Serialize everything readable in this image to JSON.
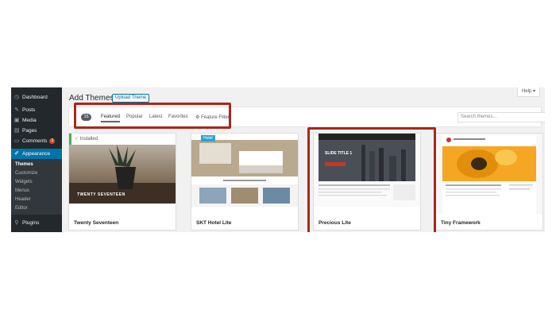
{
  "sidebar": {
    "items": [
      {
        "label": "Dashboard",
        "icon": "dashboard-icon"
      },
      {
        "label": "Posts",
        "icon": "pin-icon"
      },
      {
        "label": "Media",
        "icon": "media-icon"
      },
      {
        "label": "Pages",
        "icon": "page-icon"
      },
      {
        "label": "Comments",
        "icon": "comment-icon",
        "badge": "3"
      }
    ],
    "active": {
      "label": "Appearance",
      "icon": "paintbrush-icon"
    },
    "submenu": [
      "Themes",
      "Customize",
      "Widgets",
      "Menus",
      "Header",
      "Editor"
    ],
    "bottom": {
      "label": "Plugins",
      "icon": "plugin-icon"
    }
  },
  "header": {
    "title": "Add Themes",
    "upload_label": "Upload Theme",
    "help_label": "Help ▾"
  },
  "filter": {
    "count": "15",
    "tabs": [
      "Featured",
      "Popular",
      "Latest",
      "Favorites"
    ],
    "feature_filter": "Feature Filter",
    "search_placeholder": "Search themes..."
  },
  "themes": [
    {
      "name": "Twenty Seventeen",
      "installed": "Installed",
      "hero_text": "TWENTY SEVENTEEN"
    },
    {
      "name": "SKT Hotel Lite",
      "tag": "Hotel"
    },
    {
      "name": "Precious Lite",
      "hero_text": "SLIDE TITLE 1"
    },
    {
      "name": "Tiny Framework"
    }
  ],
  "colors": {
    "highlight": "#a7281b",
    "wp_blue": "#0073aa",
    "sidebar": "#23282d"
  }
}
